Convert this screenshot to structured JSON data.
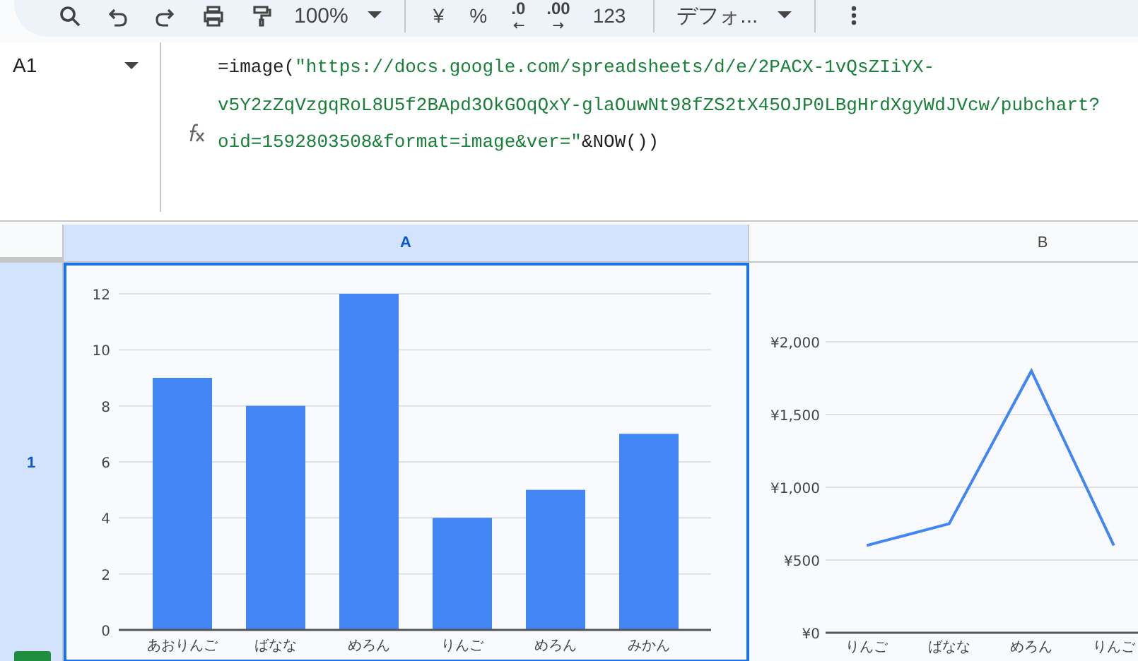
{
  "toolbar": {
    "items": [
      {
        "kind": "search"
      },
      {
        "kind": "undo"
      },
      {
        "kind": "redo"
      },
      {
        "kind": "print"
      },
      {
        "kind": "paint"
      },
      {
        "kind": "dropdown",
        "label": "100%"
      },
      {
        "kind": "divider"
      },
      {
        "kind": "text",
        "label": "¥"
      },
      {
        "kind": "text",
        "label": "%"
      },
      {
        "kind": "decrease",
        "label": ".0"
      },
      {
        "kind": "increase",
        "label": ".00"
      },
      {
        "kind": "text",
        "label": "123"
      },
      {
        "kind": "divider"
      },
      {
        "kind": "dropdown",
        "label": "デフォ..."
      },
      {
        "kind": "divider"
      },
      {
        "kind": "more"
      }
    ]
  },
  "name_box": {
    "value": "A1"
  },
  "formula_lines": [
    [
      {
        "kind": "code",
        "text": "=image("
      },
      {
        "kind": "string",
        "text": "\"https://docs.google.com/spreadsheets/d/e/2PACX-1vQsZIiYX-"
      }
    ],
    [
      {
        "kind": "string",
        "text": "v5Y2zZqVzgqRoL8U5f2BApd3OkGOqQxY-glaOuwNt98fZS2tX45OJP0LBgHrdXgyWdJVcw/pubchart?"
      }
    ],
    [
      {
        "kind": "string",
        "text": "oid=1592803508&format=image&ver=\""
      },
      {
        "kind": "code",
        "text": "&NOW())"
      }
    ]
  ],
  "columns": [
    {
      "label": "A",
      "selected": true
    },
    {
      "label": "B",
      "selected": false
    }
  ],
  "rows": [
    {
      "label": "1",
      "selected": true,
      "cells": [
        {
          "chart_data": {
            "type": "bar",
            "categories": [
              "あおりんご",
              "ばなな",
              "めろん",
              "りんご",
              "めろん",
              "みかん"
            ],
            "series": [
              {
                "color": "#4285f4",
                "values": [
                  9,
                  8,
                  12,
                  4,
                  5,
                  7
                ]
              }
            ],
            "grid": true,
            "ylim": [
              0,
              12
            ],
            "yticks": [
              0,
              2,
              4,
              6,
              8,
              10,
              12
            ]
          }
        },
        {
          "chart_data": {
            "type": "line",
            "categories": [
              "りんご",
              "ばなな",
              "めろん",
              "りんご"
            ],
            "series": [
              {
                "color": "#4285f4",
                "values": [
                  600,
                  750,
                  1800,
                  600
                ]
              }
            ],
            "grid": true,
            "ylim": [
              0,
              2000
            ],
            "yticks": [
              {
                "value": 0,
                "label": "¥0"
              },
              {
                "value": 500,
                "label": "¥500"
              },
              {
                "value": 1000,
                "label": "¥1,000"
              },
              {
                "value": 1500,
                "label": "¥1,500"
              },
              {
                "value": 2000,
                "label": "¥2,000"
              }
            ]
          }
        }
      ]
    }
  ]
}
